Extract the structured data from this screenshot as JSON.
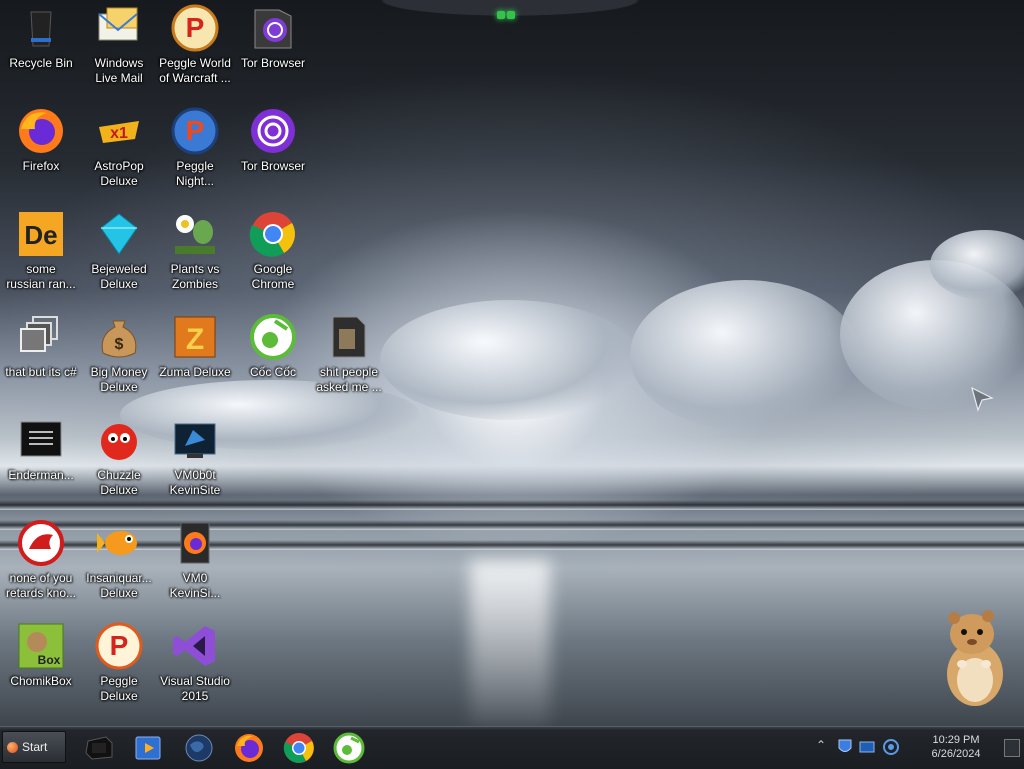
{
  "desktop": {
    "icons": [
      {
        "label": "Recycle Bin",
        "icon": "recycle-bin-icon"
      },
      {
        "label": "Windows\nLive Mail",
        "icon": "mail-icon"
      },
      {
        "label": "Peggle World\nof Warcraft ...",
        "icon": "peggle-icon"
      },
      {
        "label": "Tor Browser",
        "icon": "tor-folder-icon"
      },
      {
        "label": "Firefox",
        "icon": "firefox-icon"
      },
      {
        "label": "AstroPop\nDeluxe",
        "icon": "astropop-icon"
      },
      {
        "label": "Peggle\nNight...",
        "icon": "peggle-nights-icon"
      },
      {
        "label": "Tor Browser",
        "icon": "tor-icon"
      },
      {
        "label": "some\nrussian ran...",
        "icon": "de-icon"
      },
      {
        "label": "Bejeweled\nDeluxe",
        "icon": "gem-icon"
      },
      {
        "label": "Plants vs\nZombies",
        "icon": "plant-icon"
      },
      {
        "label": "Google\nChrome",
        "icon": "chrome-icon"
      },
      {
        "label": "that but its c#",
        "icon": "windows-stack-icon"
      },
      {
        "label": "Big Money\nDeluxe",
        "icon": "money-bag-icon"
      },
      {
        "label": "Zuma Deluxe",
        "icon": "zuma-icon"
      },
      {
        "label": "Cốc Cốc",
        "icon": "coccoc-icon"
      },
      {
        "label": "shit people\nasked me ...",
        "icon": "folder-icon"
      },
      {
        "label": "Enderman...",
        "icon": "terminal-icon"
      },
      {
        "label": "Chuzzle\nDeluxe",
        "icon": "chuzzle-icon"
      },
      {
        "label": "VM0b0t\nKevinSite",
        "icon": "vm-icon"
      },
      {
        "label": "none of you\nretards kno...",
        "icon": "dragon-icon"
      },
      {
        "label": "Insaniquar...\nDeluxe",
        "icon": "fish-icon"
      },
      {
        "label": "VM0\nKevinSi...",
        "icon": "firefox-doc-icon"
      },
      {
        "label": "ChomikBox",
        "icon": "chomikbox-icon"
      },
      {
        "label": "Peggle\nDeluxe",
        "icon": "peggle-deluxe-icon"
      },
      {
        "label": "Visual Studio\n2015",
        "icon": "visual-studio-icon"
      }
    ]
  },
  "taskbar": {
    "start_label": "Start",
    "pinned": [
      {
        "name": "terminal-app",
        "icon": "console-icon"
      },
      {
        "name": "media-player",
        "icon": "media-icon"
      },
      {
        "name": "earth-browser",
        "icon": "globe-icon"
      },
      {
        "name": "firefox",
        "icon": "firefox-icon"
      },
      {
        "name": "chrome",
        "icon": "chrome-icon"
      },
      {
        "name": "coccoc",
        "icon": "coccoc-icon"
      }
    ],
    "clock": {
      "time": "10:29 PM",
      "date": "6/26/2024"
    }
  }
}
